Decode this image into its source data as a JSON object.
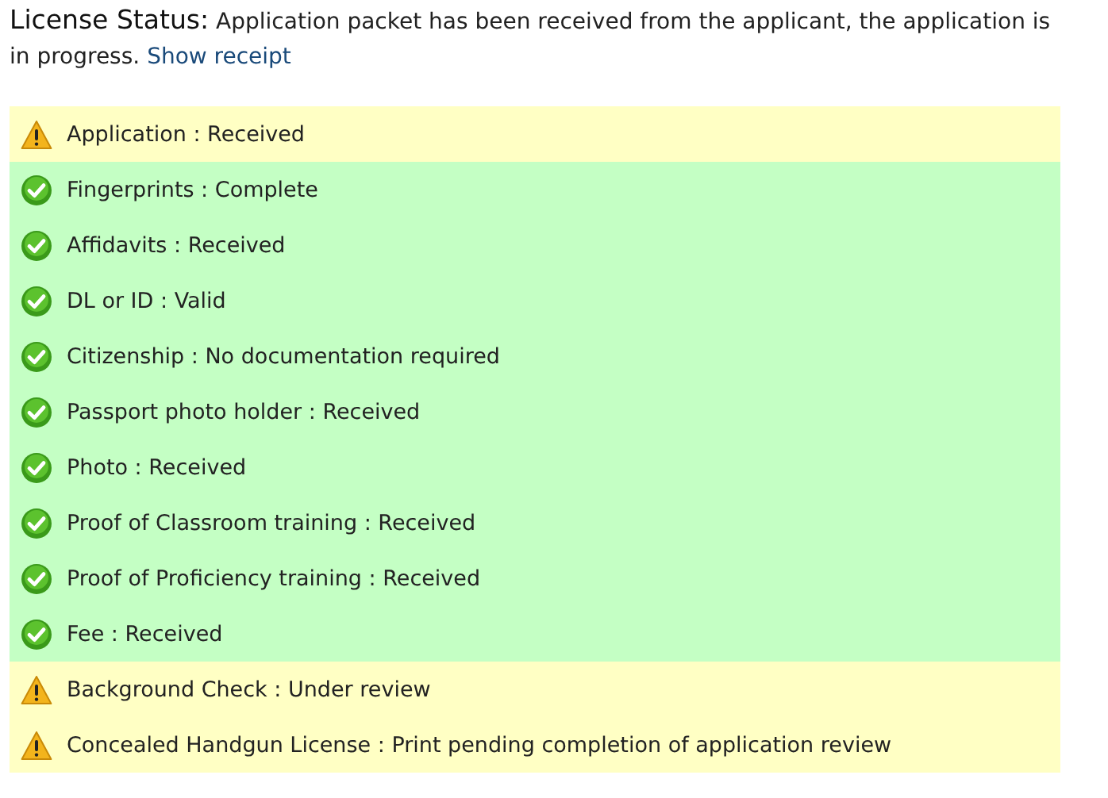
{
  "status_message": {
    "text": "**License Status:** Application packet has been received from the applicant, the application is in progress.",
    "link": "Show receipt"
  },
  "items": [
    {
      "kind": "warning",
      "text": "Application : Received"
    },
    {
      "kind": "ok",
      "text": "Fingerprints : Complete"
    },
    {
      "kind": "ok",
      "text": "Affidavits : Received"
    },
    {
      "kind": "ok",
      "text": "DL or ID : Valid"
    },
    {
      "kind": "ok",
      "text": "Citizenship : No documentation required"
    },
    {
      "kind": "ok",
      "text": "Passport photo holder : Received"
    },
    {
      "kind": "ok",
      "text": "Photo : Received"
    },
    {
      "kind": "ok",
      "text": "Proof of Classroom training : Received"
    },
    {
      "kind": "ok",
      "text": "Proof of Proficiency training : Received"
    },
    {
      "kind": "ok",
      "text": "Fee : Received"
    },
    {
      "kind": "warning",
      "text": "Background Check : Under review"
    },
    {
      "kind": "warning",
      "text": "Concealed Handgun License : Print pending completion of application review"
    }
  ]
}
